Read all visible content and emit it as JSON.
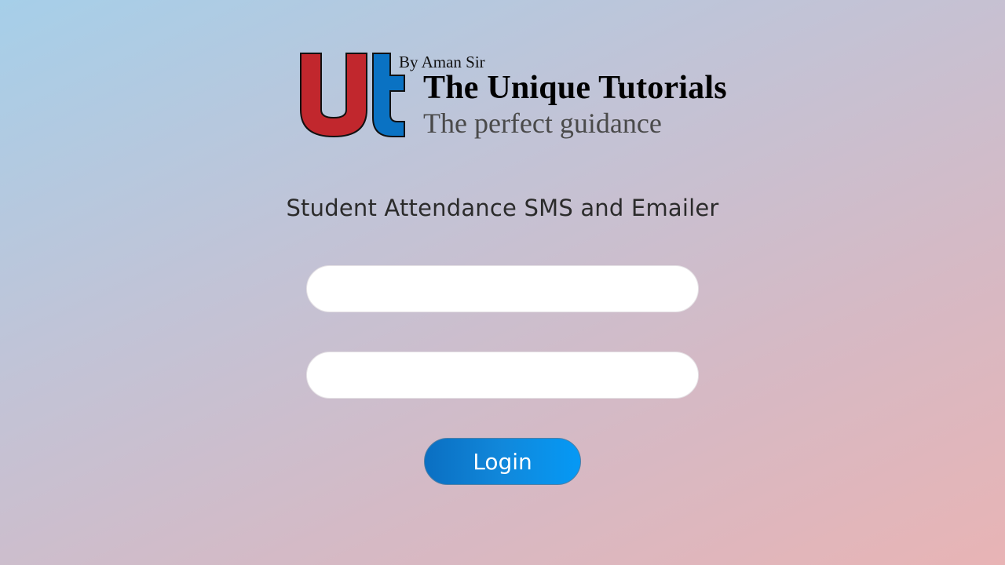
{
  "logo": {
    "mark_icon": "ut-monogram-icon",
    "byline": "By Aman Sir",
    "name": "The Unique Tutorials",
    "tagline": "The perfect guidance",
    "colors": {
      "u_red": "#c1272d",
      "t_blue": "#0a72c3"
    }
  },
  "app": {
    "title": "Student Attendance SMS and Emailer"
  },
  "form": {
    "username": {
      "value": "",
      "placeholder": ""
    },
    "password": {
      "value": "",
      "placeholder": ""
    },
    "login_label": "Login"
  },
  "colors": {
    "button_gradient_start": "#0a6fc2",
    "button_gradient_end": "#0599f5",
    "background_left": "#a6cfe9",
    "background_right": "#e8b4b5"
  }
}
